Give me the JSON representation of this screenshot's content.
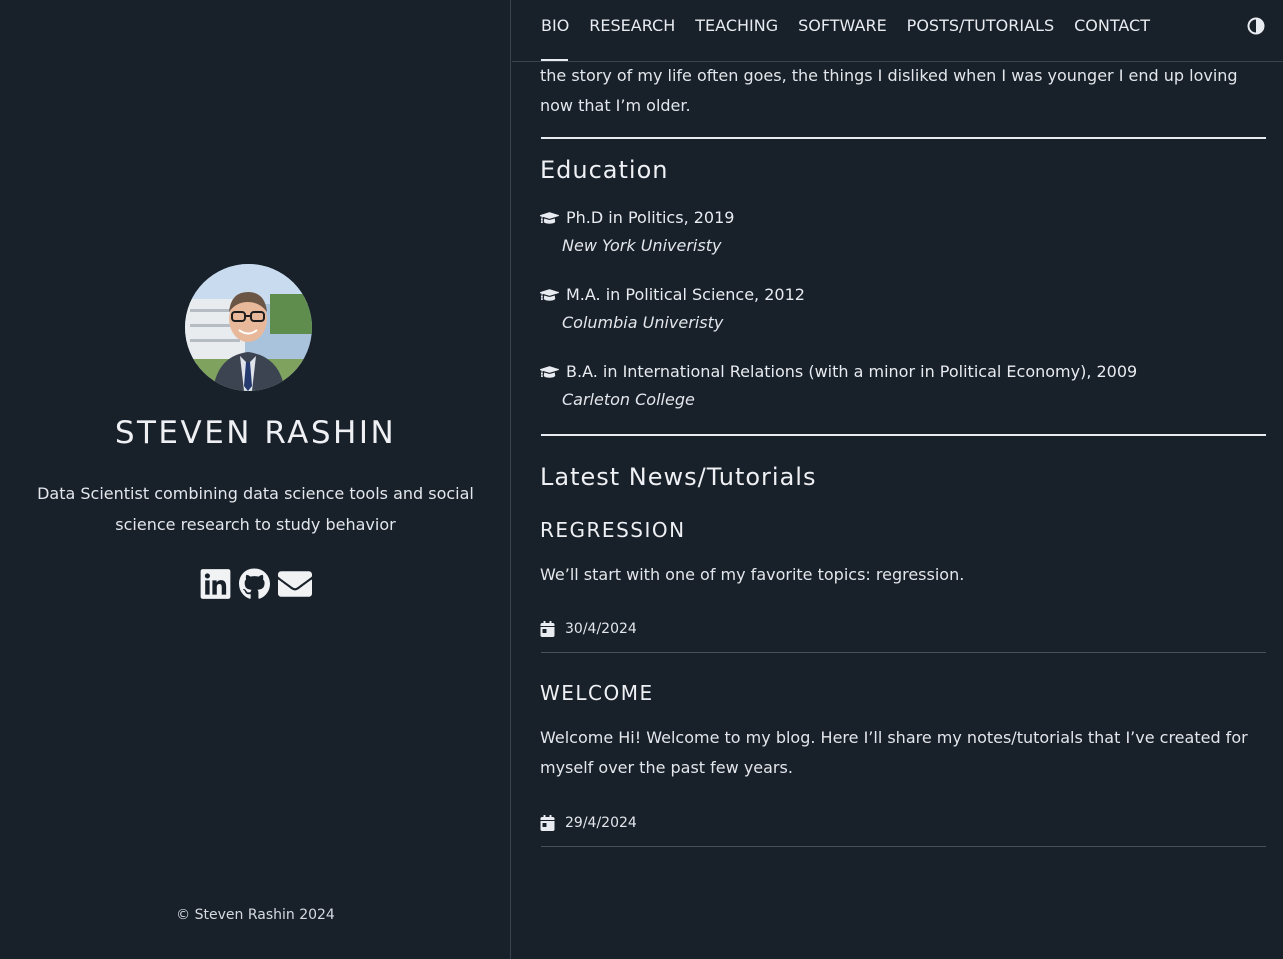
{
  "sidebar": {
    "name": "STEVEN RASHIN",
    "tagline": "Data Scientist combining data science tools and social science research to study behavior",
    "socials": [
      {
        "icon": "linkedin-icon"
      },
      {
        "icon": "github-icon"
      },
      {
        "icon": "envelope-icon"
      }
    ],
    "copyright": "© Steven Rashin 2024"
  },
  "nav": {
    "items": [
      "BIO",
      "RESEARCH",
      "TEACHING",
      "SOFTWARE",
      "POSTS/TUTORIALS",
      "CONTACT"
    ],
    "theme_icon": "contrast-icon"
  },
  "main": {
    "intro": "the story of my life often goes, the things I disliked when I was younger I end up loving now that I’m older.",
    "education": {
      "heading": "Education",
      "items": [
        {
          "degree": "Ph.D in Politics, 2019",
          "school": "New York Univeristy"
        },
        {
          "degree": "M.A. in Political Science, 2012",
          "school": "Columbia Univeristy"
        },
        {
          "degree": "B.A. in International Relations (with a minor in Political Economy), 2009",
          "school": "Carleton College"
        }
      ]
    },
    "news": {
      "heading": "Latest News/Tutorials",
      "posts": [
        {
          "title": "REGRESSION",
          "text": "We’ll start with one of my favorite topics: regression.",
          "date": "30/4/2024"
        },
        {
          "title": "WELCOME",
          "text": "Welcome Hi! Welcome to my blog. Here I’ll share my notes/tutorials that I’ve created for myself over the past few years.",
          "date": "29/4/2024"
        }
      ]
    }
  },
  "colors": {
    "background": "#18202a",
    "text": "#e8ebef",
    "divider": "#3a434d"
  }
}
